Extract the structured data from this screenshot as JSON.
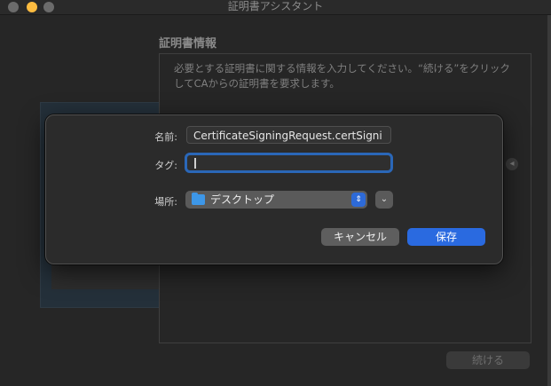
{
  "window": {
    "title": "証明書アシスタント"
  },
  "background": {
    "section_title": "証明書情報",
    "description": "必要とする証明書に関する情報を入力してください。“続ける”をクリックしてCAからの証明書を要求します。",
    "continue_label": "続ける"
  },
  "sheet": {
    "name_label": "名前:",
    "name_value": "CertificateSigningRequest.certSigni",
    "tag_label": "タグ:",
    "tag_value": "",
    "where_label": "場所:",
    "location_value": "デスクトップ",
    "cancel_label": "キャンセル",
    "save_label": "保存"
  },
  "icons": {
    "folder": "folder-icon",
    "select_arrows": "chevron-up-down-icon",
    "expand": "chevron-down-icon"
  },
  "colors": {
    "accent": "#2a6ae0",
    "focus_ring": "#2a67b8",
    "folder": "#3d97e8",
    "minimize": "#fdbc40"
  }
}
